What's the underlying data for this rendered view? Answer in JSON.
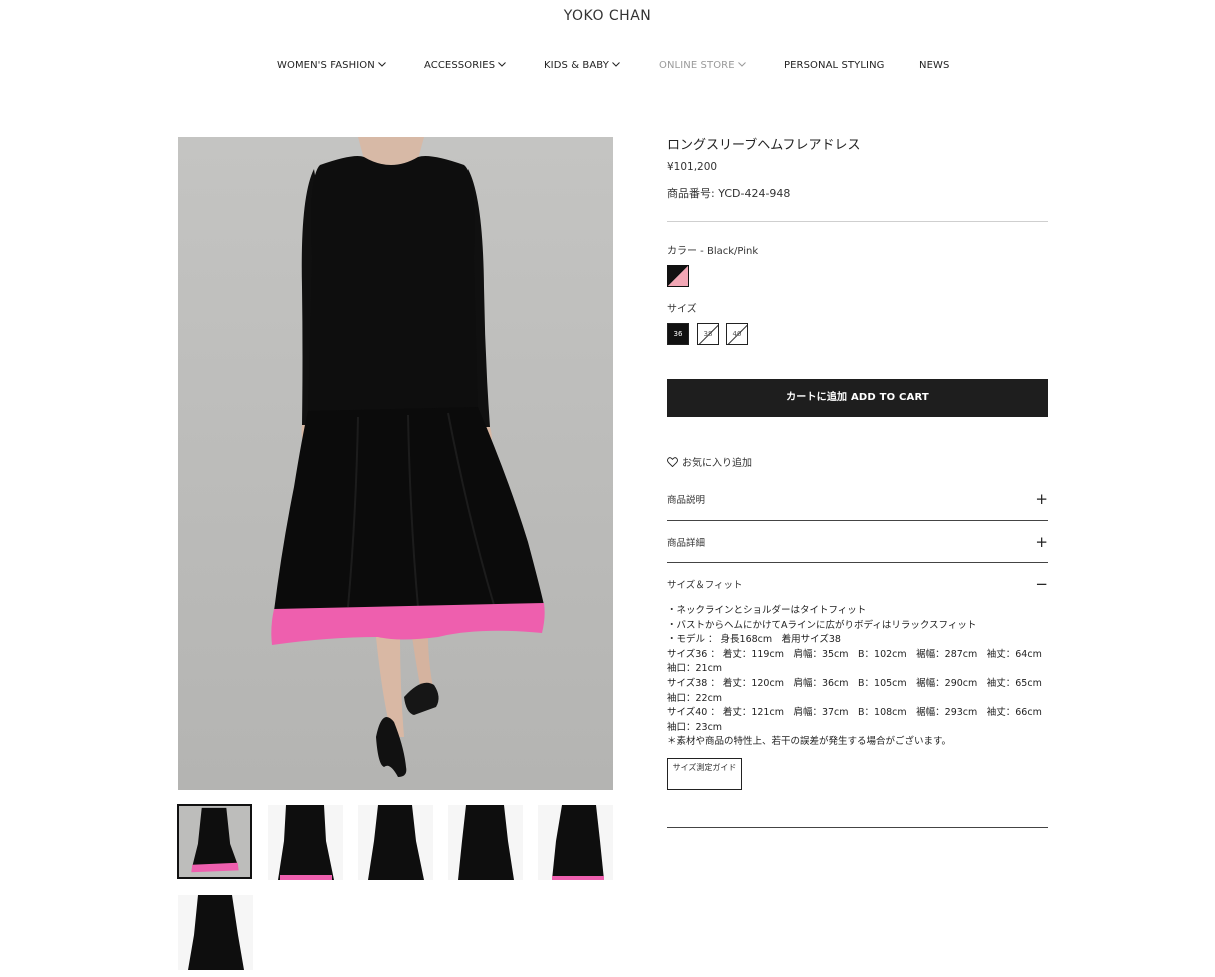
{
  "brand": "YOKO CHAN",
  "nav": [
    {
      "label": "WOMEN'S FASHION",
      "dropdown": true
    },
    {
      "label": "ACCESSORIES",
      "dropdown": true
    },
    {
      "label": "KIDS & BABY",
      "dropdown": true
    },
    {
      "label": "ONLINE STORE",
      "dropdown": true,
      "muted": true
    },
    {
      "label": "PERSONAL STYLING",
      "dropdown": false
    },
    {
      "label": "NEWS",
      "dropdown": false
    }
  ],
  "product": {
    "title": "ロングスリーブヘムフレアドレス",
    "price": "¥101,200",
    "sku_label": "商品番号:",
    "sku_value": "YCD-424-948"
  },
  "color": {
    "label": "カラー - Black/Pink",
    "swatch_colors": [
      "#111111",
      "#f2a7b5"
    ]
  },
  "size": {
    "label": "サイズ",
    "options": [
      {
        "label": "36",
        "selected": true,
        "available": true
      },
      {
        "label": "38",
        "selected": false,
        "available": false
      },
      {
        "label": "40",
        "selected": false,
        "available": false
      }
    ]
  },
  "cart_button": "カートに追加 ADD TO CART",
  "favorite": "お気に入り追加",
  "accordion": [
    {
      "label": "商品説明",
      "icon": "plus-icon",
      "symbol": "+"
    },
    {
      "label": "商品詳細",
      "icon": "plus-icon",
      "symbol": "+"
    },
    {
      "label": "サイズ＆フィット",
      "icon": "minus-icon",
      "symbol": "−"
    }
  ],
  "fit_lines": [
    "・ネックラインとショルダーはタイトフィット",
    "・バストからヘムにかけてAラインに広がりボディはリラックスフィット",
    "・モデル ： 身長168cm　着用サイズ38",
    "サイズ36 ：  着丈：119cm　肩幅：35cm　B：102cm　裾幅：287cm　袖丈：64cm",
    "袖口：21cm",
    "サイズ38 ：  着丈：120cm　肩幅：36cm　B：105cm　裾幅：290cm　袖丈：65cm",
    "袖口：22cm",
    "サイズ40 ：  着丈：121cm　肩幅：37cm　B：108cm　裾幅：293cm　袖丈：66cm",
    "袖口：23cm",
    "＊素材や商品の特性上、若干の誤差が発生する場合がございます。"
  ],
  "size_guide_button": "サイズ測定ガイド",
  "colors": {
    "dress": "#0d0d0d",
    "hem": "#ee5fae",
    "photo_bg": "#bdbdbb",
    "button": "#1e1e1e"
  },
  "thumbnails": 6,
  "active_thumbnail": 1
}
